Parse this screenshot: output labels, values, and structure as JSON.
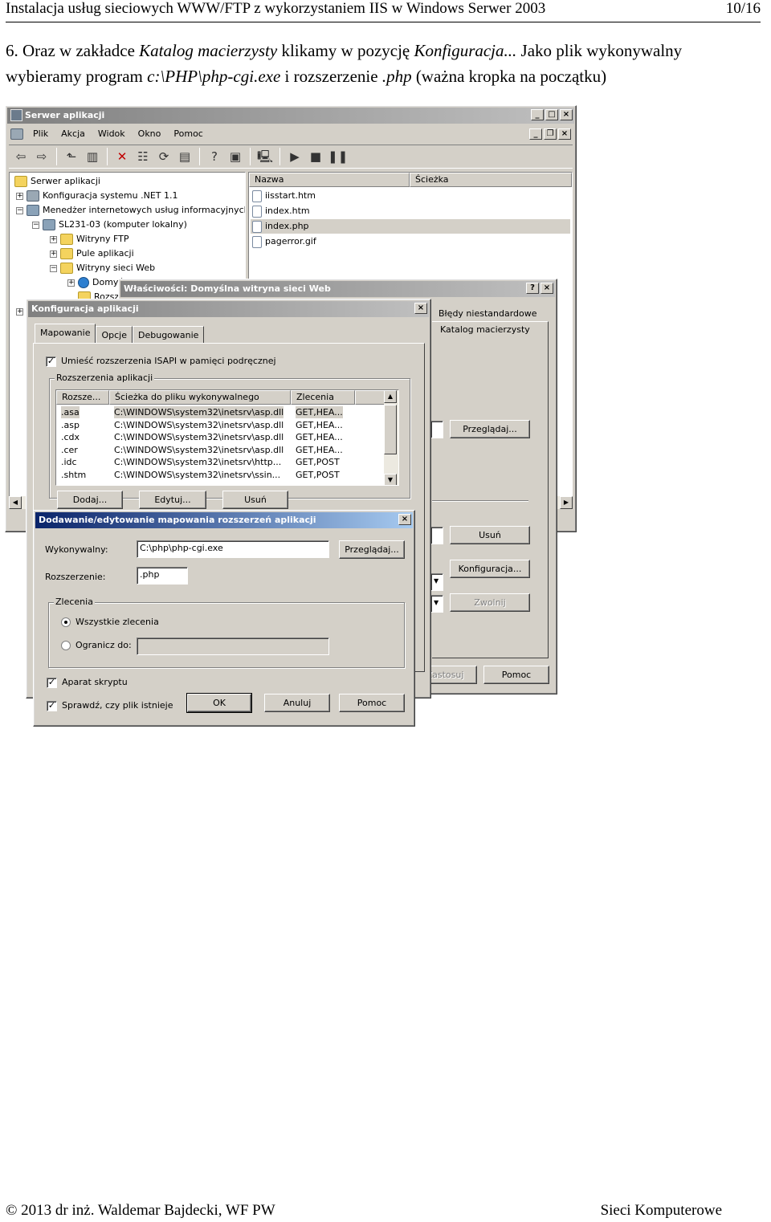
{
  "doc": {
    "header_title": "Instalacja usług sieciowych WWW/FTP z wykorzystaniem IIS w Windows Serwer 2003",
    "page_number": "10/16",
    "para_line1_a": "6. Oraz w zakładce ",
    "para_line1_b": "Katalog macierzysty",
    "para_line1_c": " klikamy w pozycję ",
    "para_line1_d": "Konfiguracja...",
    "para_line1_e": " Jako plik wykonywalny",
    "para_line2_a": "wybieramy program ",
    "para_line2_b": "c:\\PHP\\php-cgi.exe",
    "para_line2_c": " i rozszerzenie ",
    "para_line2_d": ".php",
    "para_line2_e": " (ważna kropka na początku)",
    "footer_left": "© 2013 dr inż. Waldemar Bajdecki, WF PW",
    "footer_right": "Sieci Komputerowe"
  },
  "main_window": {
    "title": "Serwer aplikacji",
    "menu": [
      "Plik",
      "Akcja",
      "Widok",
      "Okno",
      "Pomoc"
    ],
    "tree": [
      "Serwer aplikacji",
      "Konfiguracja systemu .NET 1.1",
      "Menedżer internetowych usług informacyjnych",
      "SL231-03 (komputer lokalny)",
      "Witryny FTP",
      "Pule aplikacji",
      "Witryny sieci Web",
      "Domyślna witryna sieci Web",
      "Rozszerzenia usługi sieci Web"
    ],
    "columns": [
      "Nazwa",
      "Ścieżka"
    ],
    "files": [
      "iisstart.htm",
      "index.htm",
      "index.php",
      "pagerror.gif"
    ]
  },
  "props_window": {
    "title": "Właściwości: Domyślna witryna sieci Web",
    "tab_errors": "Błędy niestandardowe",
    "tab_home": "Katalog macierzysty",
    "browse": "Przeglądaj...",
    "remove": "Usuń",
    "configure": "Konfiguracja...",
    "unload": "Zwolnij",
    "apply": "Zastosuj",
    "help": "Pomoc"
  },
  "config_window": {
    "title": "Konfiguracja aplikacji",
    "tabs": [
      "Mapowanie",
      "Opcje",
      "Debugowanie"
    ],
    "cache_isapi": "Umieść rozszerzenia ISAPI w pamięci podręcznej",
    "group_label": "Rozszerzenia aplikacji",
    "columns": [
      "Rozsze...",
      "Ścieżka do pliku wykonywalnego",
      "Zlecenia"
    ],
    "rows": [
      {
        "ext": ".asa",
        "path": "C:\\WINDOWS\\system32\\inetsrv\\asp.dll",
        "verbs": "GET,HEA..."
      },
      {
        "ext": ".asp",
        "path": "C:\\WINDOWS\\system32\\inetsrv\\asp.dll",
        "verbs": "GET,HEA..."
      },
      {
        "ext": ".cdx",
        "path": "C:\\WINDOWS\\system32\\inetsrv\\asp.dll",
        "verbs": "GET,HEA..."
      },
      {
        "ext": ".cer",
        "path": "C:\\WINDOWS\\system32\\inetsrv\\asp.dll",
        "verbs": "GET,HEA..."
      },
      {
        "ext": ".idc",
        "path": "C:\\WINDOWS\\system32\\inetsrv\\http...",
        "verbs": "GET,POST"
      },
      {
        "ext": ".shtm",
        "path": "C:\\WINDOWS\\system32\\inetsrv\\ssin...",
        "verbs": "GET,POST"
      }
    ],
    "add": "Dodaj...",
    "edit": "Edytuj...",
    "remove": "Usuń"
  },
  "edit_dialog": {
    "title": "Dodawanie/edytowanie mapowania rozszerzeń aplikacji",
    "exe_label": "Wykonywalny:",
    "exe_value": "C:\\php\\php-cgi.exe",
    "browse": "Przeglądaj...",
    "ext_label": "Rozszerzenie:",
    "ext_value": ".php",
    "verbs_group": "Zlecenia",
    "all_verbs": "Wszystkie zlecenia",
    "limit_to": "Ogranicz do:",
    "script_engine": "Aparat skryptu",
    "check_file": "Sprawdź, czy plik istnieje",
    "ok": "OK",
    "cancel": "Anuluj",
    "help": "Pomoc"
  }
}
